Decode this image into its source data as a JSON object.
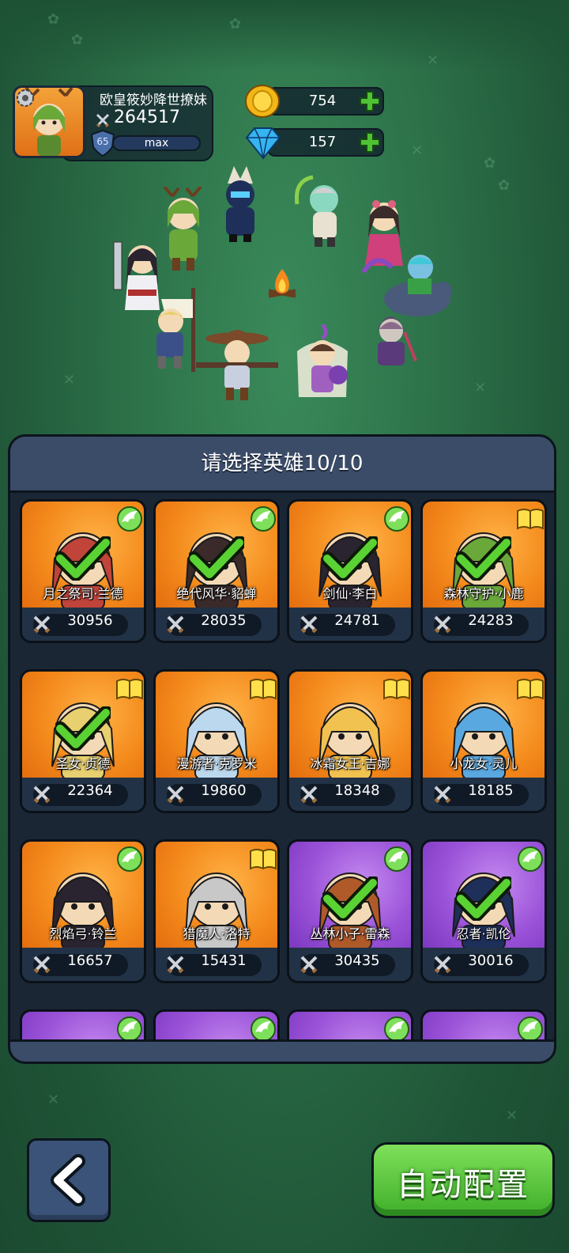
{
  "player": {
    "name": "欧皇筱妙降世撩妹",
    "power": "264517",
    "level": "65",
    "xp_label": "max"
  },
  "currency": {
    "gold": "754",
    "diamond": "157"
  },
  "panel": {
    "title": "请选择英雄10/10"
  },
  "heroes": [
    {
      "name": "月之祭司·兰德",
      "power": "30956",
      "bg": "orange",
      "badge": "wing",
      "selected": true,
      "color": "#c0443a"
    },
    {
      "name": "绝代风华·貂蝉",
      "power": "28035",
      "bg": "orange",
      "badge": "wing",
      "selected": true,
      "color": "#3a2a2a"
    },
    {
      "name": "剑仙·李白",
      "power": "24781",
      "bg": "orange",
      "badge": "wing",
      "selected": true,
      "color": "#2a2430"
    },
    {
      "name": "森林守护·小鹿",
      "power": "24283",
      "bg": "orange",
      "badge": "book",
      "selected": true,
      "color": "#6aa83a"
    },
    {
      "name": "圣女·贞德",
      "power": "22364",
      "bg": "orange",
      "badge": "book",
      "selected": true,
      "color": "#e8d070"
    },
    {
      "name": "漫游者·克罗米",
      "power": "19860",
      "bg": "orange",
      "badge": "book",
      "selected": false,
      "color": "#bcd8ee"
    },
    {
      "name": "冰霜女王·吉娜",
      "power": "18348",
      "bg": "orange",
      "badge": "book",
      "selected": false,
      "color": "#f2c250"
    },
    {
      "name": "小龙女·灵儿",
      "power": "18185",
      "bg": "orange",
      "badge": "book",
      "selected": false,
      "color": "#5aa8e0"
    },
    {
      "name": "烈焰弓·铃兰",
      "power": "16657",
      "bg": "orange",
      "badge": "wing",
      "selected": false,
      "color": "#2a2430"
    },
    {
      "name": "猎魔人·洛特",
      "power": "15431",
      "bg": "orange",
      "badge": "book",
      "selected": false,
      "color": "#c8c8c8"
    },
    {
      "name": "丛林小子·雷森",
      "power": "30435",
      "bg": "purple",
      "badge": "wing",
      "selected": true,
      "color": "#b05a2a"
    },
    {
      "name": "忍者·凯伦",
      "power": "30016",
      "bg": "purple",
      "badge": "wing",
      "selected": true,
      "color": "#1e2f5a"
    },
    {
      "name": "",
      "power": "",
      "bg": "purple",
      "badge": "wing",
      "selected": false,
      "color": "#b03030"
    },
    {
      "name": "",
      "power": "",
      "bg": "purple",
      "badge": "wing",
      "selected": false,
      "color": "#e8e0d0"
    },
    {
      "name": "",
      "power": "",
      "bg": "purple",
      "badge": "wing",
      "selected": false,
      "color": "#7a4a2a"
    },
    {
      "name": "",
      "power": "",
      "bg": "purple",
      "badge": "wing",
      "selected": false,
      "color": "#e0b040"
    }
  ],
  "buttons": {
    "back_icon": "chevron-left-icon",
    "auto_label": "自动配置"
  },
  "colors": {
    "accent_green": "#4fc234",
    "panel_header": "#3b4c68",
    "card_orange": "#f48a1c",
    "card_purple": "#9a52d8"
  }
}
